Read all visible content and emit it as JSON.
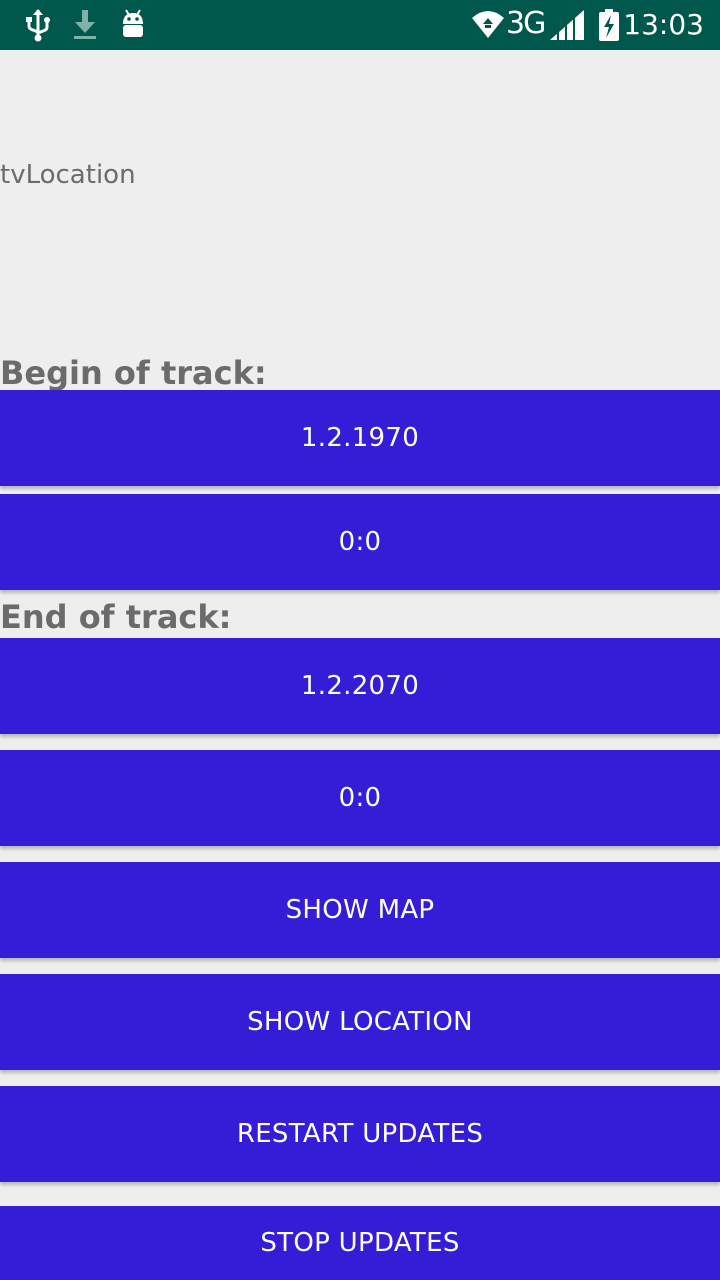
{
  "status_bar": {
    "time": "13:03",
    "network_type": "3G",
    "icons": [
      "usb-icon",
      "download-icon",
      "android-icon",
      "wifi-icon",
      "signal-icon",
      "battery-charging-icon"
    ]
  },
  "main": {
    "location_text": "tvLocation",
    "begin_label": "Begin of track:",
    "begin_date": "1.2.1970",
    "begin_time": "0:0",
    "end_label": "End of track:",
    "end_date": "1.2.2070",
    "end_time": "0:0",
    "show_map": "SHOW MAP",
    "show_location": "SHOW LOCATION",
    "restart_updates": "RESTART UPDATES",
    "stop_updates": "STOP UPDATES"
  },
  "colors": {
    "status_bar": "#00574b",
    "button": "#351dd8",
    "background": "#eeeeee",
    "label_text": "#6b6b6b"
  }
}
